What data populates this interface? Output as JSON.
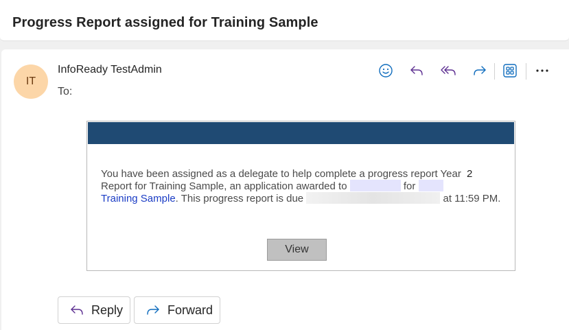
{
  "subject": "Progress Report assigned for Training Sample",
  "message": {
    "avatar_initials": "IT",
    "sender": "InfoReady TestAdmin",
    "to_label": "To:"
  },
  "toolbar": {
    "icons": [
      "smiley-icon",
      "reply-icon",
      "reply-all-icon",
      "forward-icon",
      "apps-icon",
      "more-icon"
    ]
  },
  "email_body": {
    "text_part1": "You have been assigned as a delegate to help complete a progress report Year",
    "year_number": "2",
    "text_part2": "Report for Training Sample, an application awarded to",
    "text_for": "for",
    "link_text": "Training Sample",
    "text_part3": ". This progress report is due",
    "text_time": "at 11:59 PM.",
    "view_button": "View",
    "banner_color": "#1f4a73"
  },
  "footer": {
    "reply_label": "Reply",
    "forward_label": "Forward"
  },
  "colors": {
    "accent": "#0f6cbd",
    "reply_icon": "#5c2e91",
    "avatar_bg": "#fcd6a8"
  }
}
